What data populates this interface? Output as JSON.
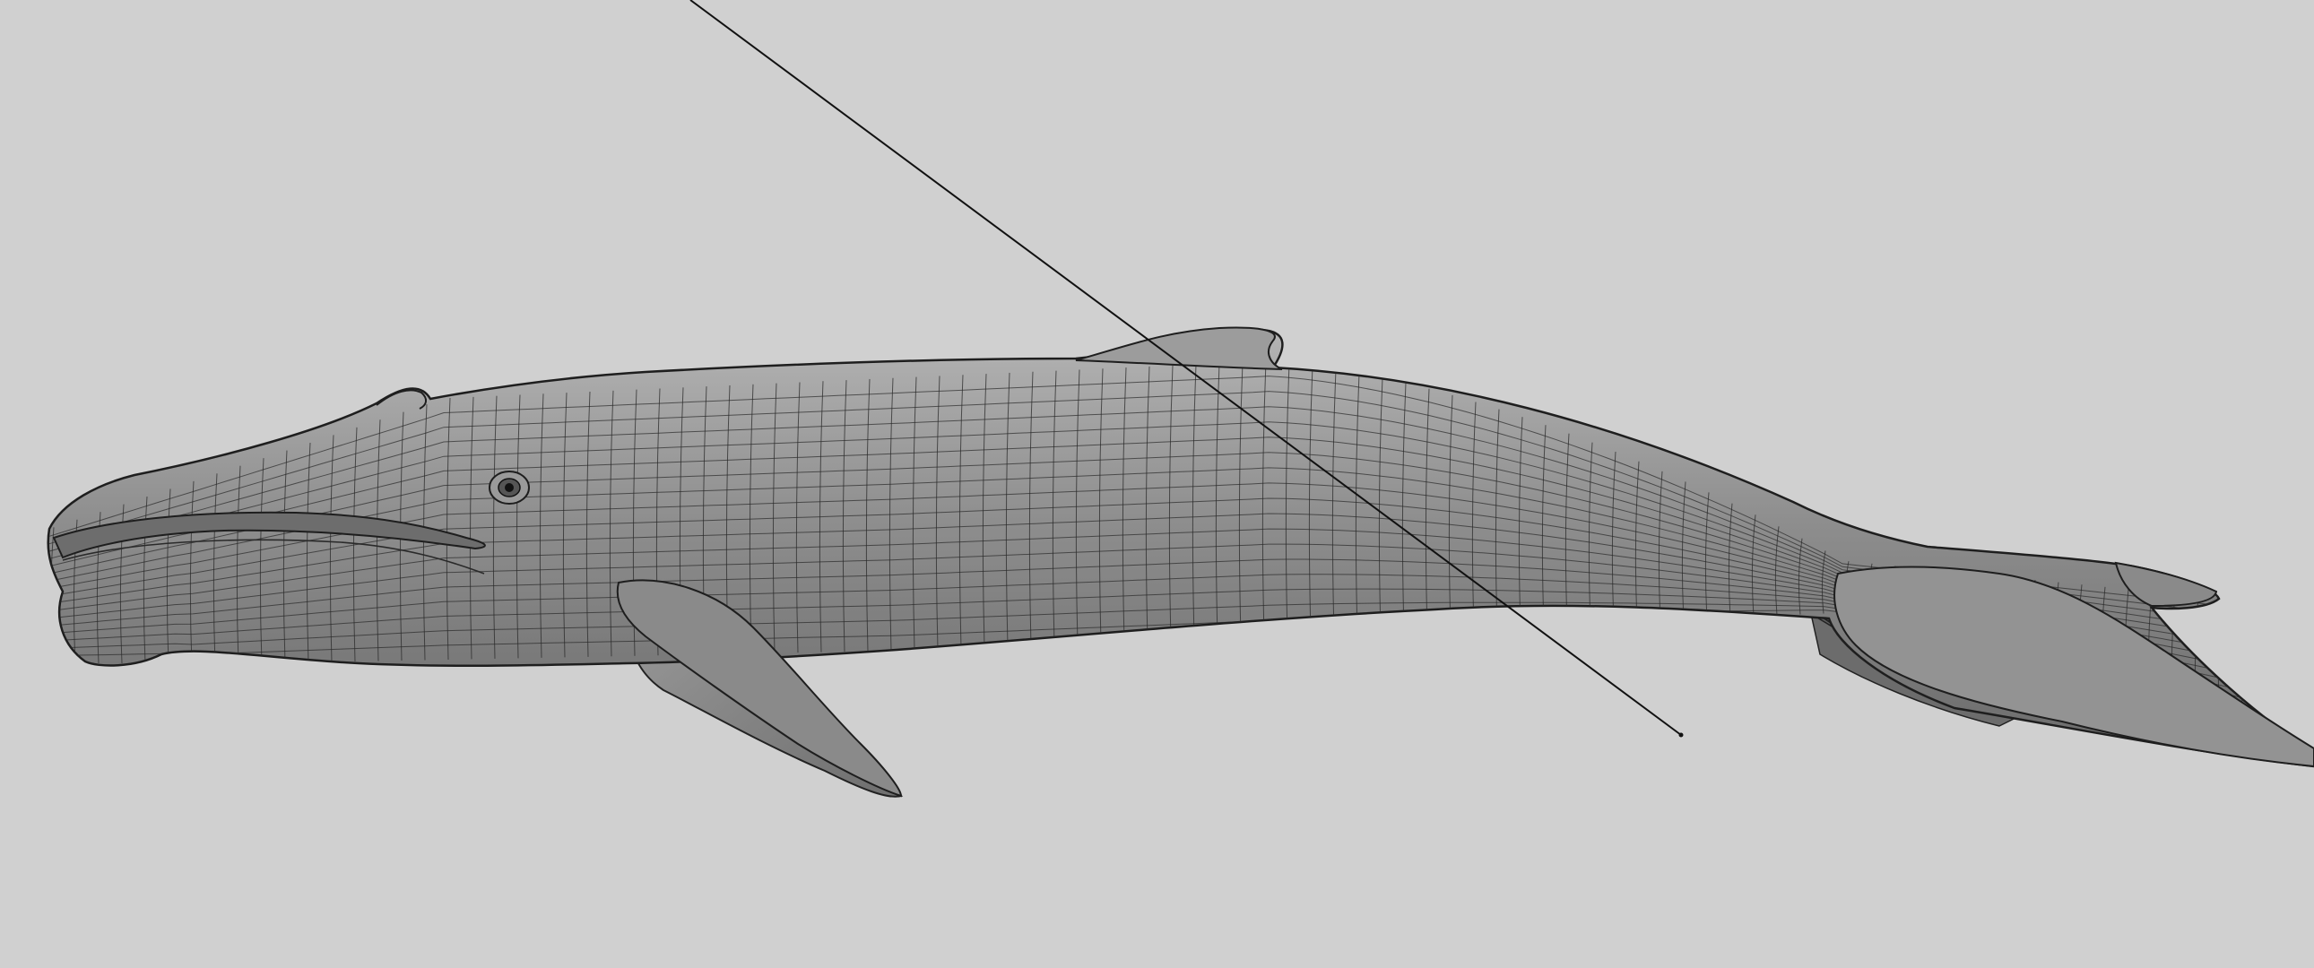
{
  "viewport": {
    "background": "#d0d0d0",
    "shading": "smooth-shade-wireframe-on-shaded",
    "mesh_color": "#8e8e8e",
    "wire_color": "#2a2a2a"
  },
  "model": {
    "icon": "whale-mesh-icon"
  }
}
